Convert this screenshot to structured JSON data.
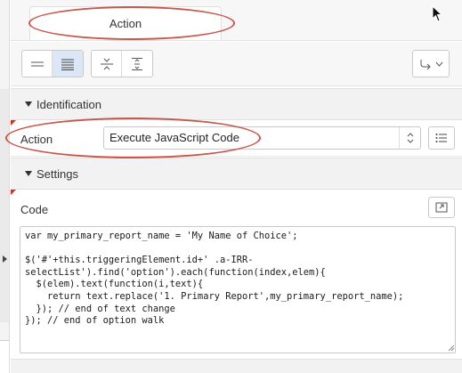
{
  "tabs": {
    "action_label": "Action"
  },
  "toolbar": {
    "layout_buttons": [
      "one-line-icon",
      "lines-icon",
      "split-vertical-icon",
      "align-middle-icon"
    ],
    "menu_icon": "arrow-redirect-icon"
  },
  "identification": {
    "section_title": "Identification",
    "action_label": "Action",
    "action_value": "Execute JavaScript Code"
  },
  "settings": {
    "section_title": "Settings",
    "code_label": "Code",
    "code_value": "var my_primary_report_name = 'My Name of Choice';\n\n$('#'+this.triggeringElement.id+' .a-IRR-selectList').find('option').each(function(index,elem){\n  $(elem).text(function(i,text){\n    return text.replace('1. Primary Report',my_primary_report_name);\n  }); // end of text change\n}); // end of option walk"
  },
  "colors": {
    "callout": "#c8564b",
    "required_marker": "#e0281b",
    "active_button": "#dbe7f6"
  }
}
